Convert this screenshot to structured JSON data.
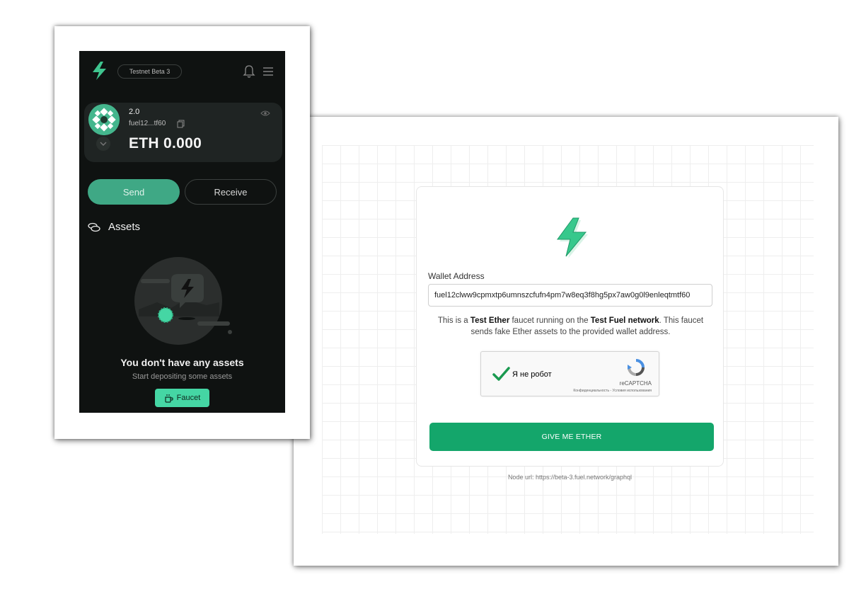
{
  "faucet": {
    "wallet_label": "Wallet Address",
    "wallet_value": "fuel12clww9cpmxtp6umnszcfufn4pm7w8eq3f8hg5px7aw0g0l9enleqtmtf60",
    "desc_prefix": "This is a ",
    "desc_bold1": "Test Ether",
    "desc_mid": " faucet running on the ",
    "desc_bold2": "Test Fuel network",
    "desc_suffix": ". This faucet sends fake Ether assets to the provided wallet address.",
    "captcha_label": "Я не робот",
    "captcha_brand": "reCAPTCHA",
    "captcha_links": "Конфиденциальность - Условия использования",
    "button_label": "GIVE ME ETHER",
    "node_url": "Node url: https://beta-3.fuel.network/graphql",
    "accent_color": "#14a66b"
  },
  "wallet": {
    "network_badge": "Testnet Beta 3",
    "account_name": "2.0",
    "account_address": "fuel12...tf60",
    "balance": "ETH 0.000",
    "send_label": "Send",
    "receive_label": "Receive",
    "assets_title": "Assets",
    "empty_title": "You don't have any assets",
    "empty_subtitle": "Start depositing some assets",
    "faucet_label": "Faucet",
    "accent_color": "#3fa885"
  }
}
